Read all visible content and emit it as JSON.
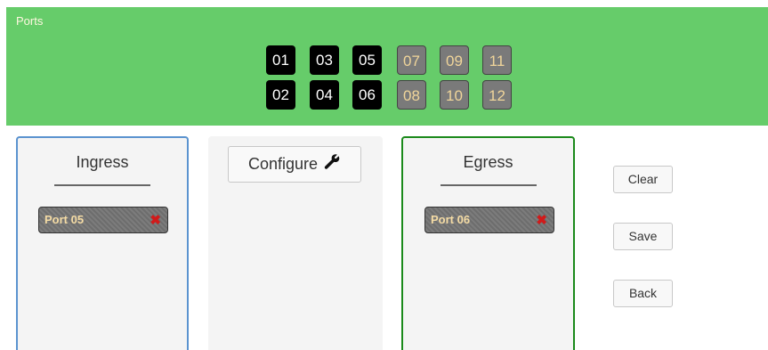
{
  "ports": {
    "title": "Ports",
    "top_row": [
      {
        "label": "01",
        "state": "active"
      },
      {
        "label": "03",
        "state": "active"
      },
      {
        "label": "05",
        "state": "active"
      },
      {
        "label": "07",
        "state": "inactive"
      },
      {
        "label": "09",
        "state": "inactive"
      },
      {
        "label": "11",
        "state": "inactive"
      }
    ],
    "bottom_row": [
      {
        "label": "02",
        "state": "active"
      },
      {
        "label": "04",
        "state": "active"
      },
      {
        "label": "06",
        "state": "active"
      },
      {
        "label": "08",
        "state": "inactive"
      },
      {
        "label": "10",
        "state": "inactive"
      },
      {
        "label": "12",
        "state": "inactive"
      }
    ]
  },
  "ingress": {
    "title": "Ingress",
    "chips": [
      {
        "label": "Port 05",
        "remove_icon": "close-x-icon"
      }
    ]
  },
  "middle": {
    "configure_label": "Configure",
    "configure_icon": "wrench-icon"
  },
  "egress": {
    "title": "Egress",
    "chips": [
      {
        "label": "Port 06",
        "remove_icon": "close-x-icon"
      }
    ]
  },
  "actions": {
    "clear": "Clear",
    "save": "Save",
    "back": "Back"
  },
  "colors": {
    "ports_bg": "#66cc6a",
    "ingress_border": "#5b93cf",
    "egress_border": "#1b8a1b",
    "remove_x": "#d11a1a"
  }
}
